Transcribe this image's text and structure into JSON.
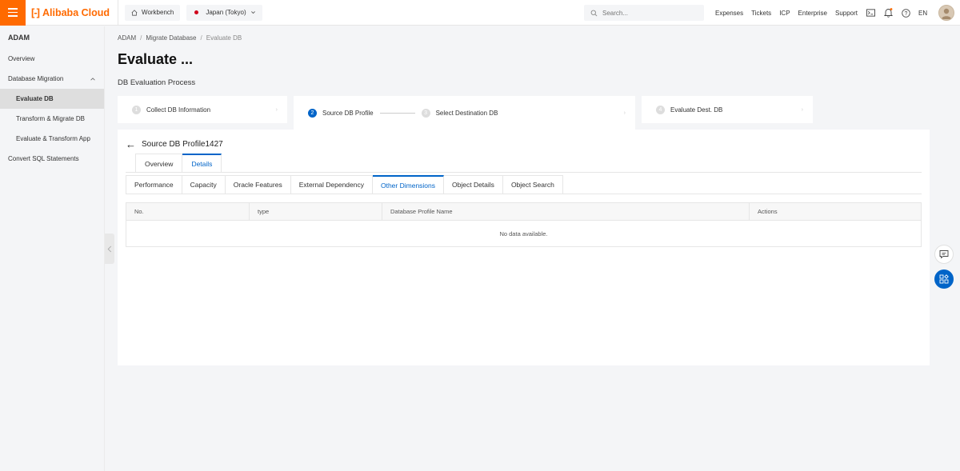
{
  "topbar": {
    "brand": "Alibaba Cloud",
    "workbench": "Workbench",
    "region": "Japan (Tokyo)",
    "search_placeholder": "Search...",
    "links": [
      "Expenses",
      "Tickets",
      "ICP",
      "Enterprise",
      "Support"
    ],
    "language": "EN",
    "accent_color": "#ff6a00"
  },
  "sidebar": {
    "title": "ADAM",
    "items": [
      {
        "label": "Overview"
      },
      {
        "label": "Database Migration"
      },
      {
        "label": "Evaluate DB"
      },
      {
        "label": "Transform & Migrate DB"
      },
      {
        "label": "Evaluate & Transform App"
      },
      {
        "label": "Convert SQL Statements"
      }
    ]
  },
  "breadcrumb": [
    "ADAM",
    "Migrate Database",
    "Evaluate DB"
  ],
  "page": {
    "title": "Evaluate ...",
    "process_title": "DB Evaluation Process"
  },
  "steps": [
    {
      "num": "1",
      "label": "Collect DB Information"
    },
    {
      "num": "2",
      "label": "Source DB Profile"
    },
    {
      "num": "3",
      "label": "Select Destination DB"
    },
    {
      "num": "4",
      "label": "Evaluate Dest. DB"
    }
  ],
  "profile": {
    "name": "Source DB Profile1427",
    "tabs": [
      "Overview",
      "Details"
    ],
    "sub_tabs": [
      "Performance",
      "Capacity",
      "Oracle Features",
      "External Dependency",
      "Other Dimensions",
      "Object Details",
      "Object Search"
    ]
  },
  "table": {
    "columns": [
      "No.",
      "type",
      "Database Profile Name",
      "Actions"
    ],
    "empty_text": "No data available."
  },
  "colors": {
    "primary": "#0064c8"
  }
}
